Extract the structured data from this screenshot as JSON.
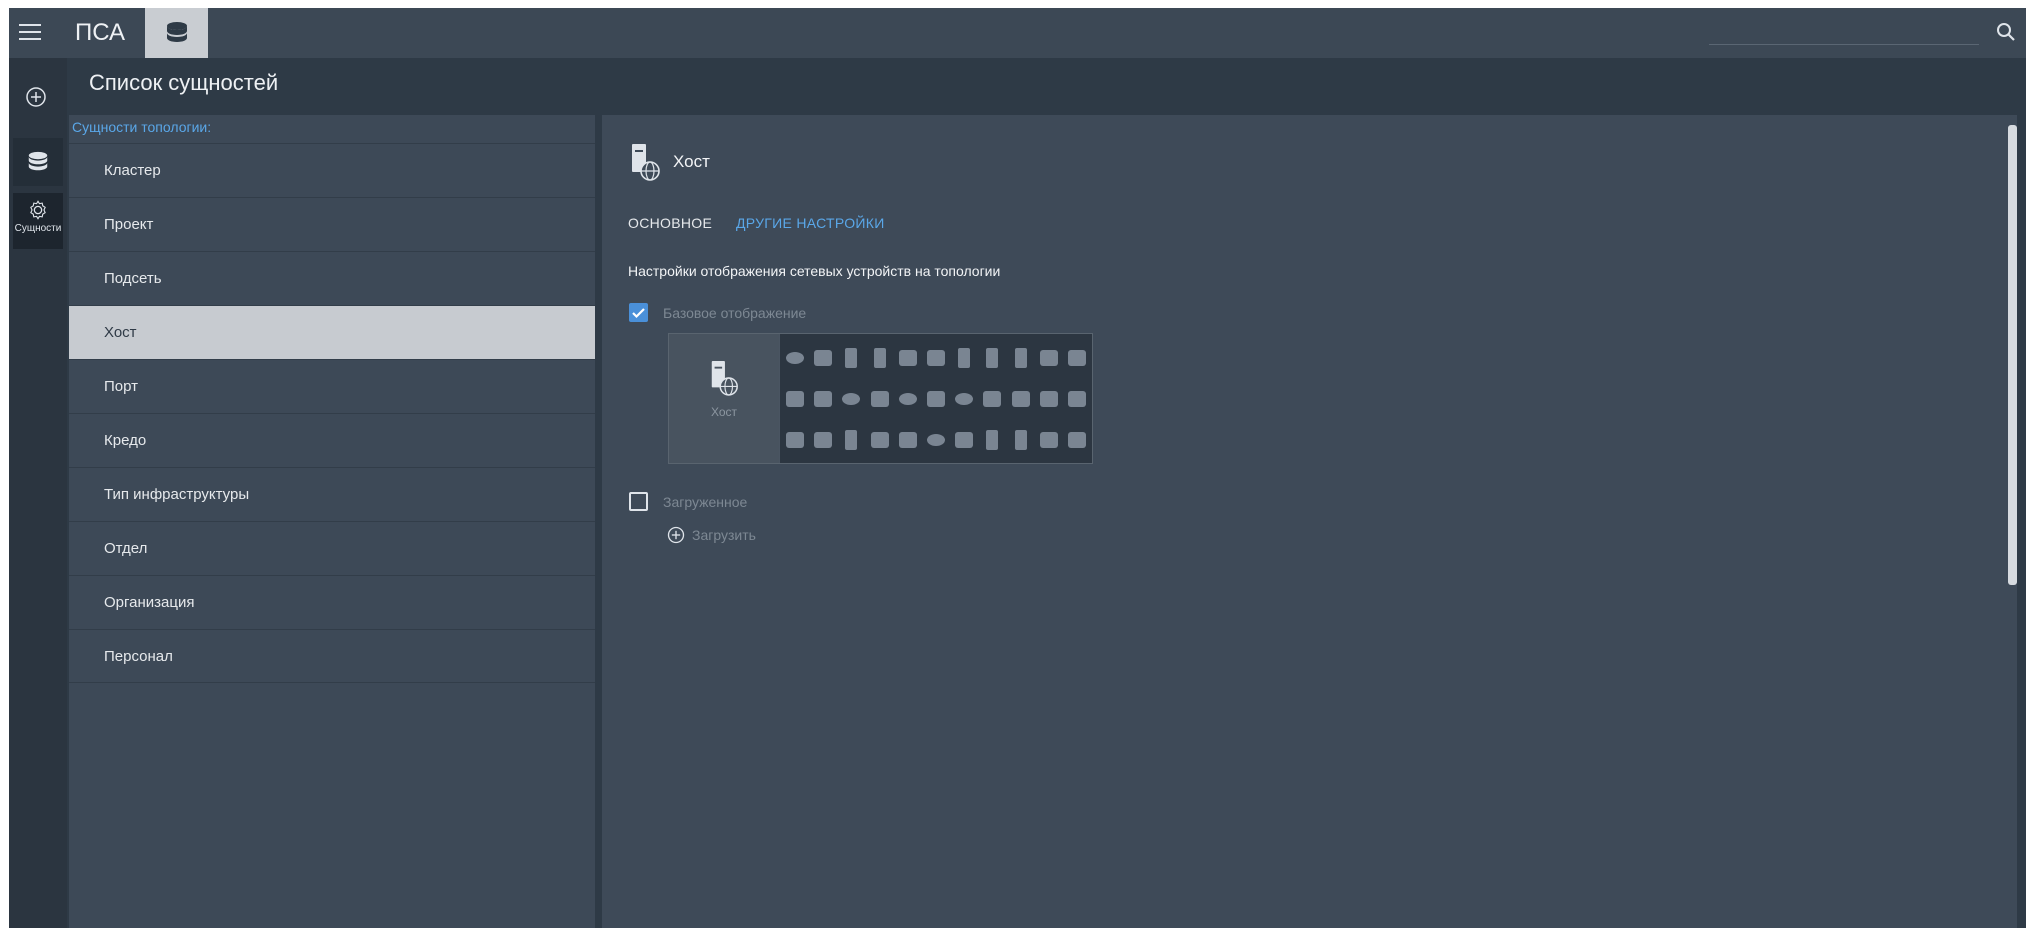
{
  "app": {
    "title": "ПСА"
  },
  "page": {
    "title": "Список сущностей"
  },
  "rail": {
    "entities_label": "Сущности"
  },
  "entities": {
    "header": "Сущности топологии:",
    "items": [
      {
        "label": "Кластер"
      },
      {
        "label": "Проект"
      },
      {
        "label": "Подсеть"
      },
      {
        "label": "Хост",
        "selected": true
      },
      {
        "label": "Порт"
      },
      {
        "label": "Кредо"
      },
      {
        "label": "Тип инфраструктуры"
      },
      {
        "label": "Отдел"
      },
      {
        "label": "Организация"
      },
      {
        "label": "Персонал"
      }
    ]
  },
  "detail": {
    "title": "Хост",
    "tabs": [
      {
        "label": "ОСНОВНОЕ",
        "active": true
      },
      {
        "label": "ДРУГИЕ НАСТРОЙКИ",
        "active": false
      }
    ],
    "section_label": "Настройки отображения сетевых устройств на топологии",
    "base_display": {
      "label": "Базовое отображение",
      "checked": true
    },
    "preview": {
      "label": "Хост"
    },
    "loaded": {
      "label": "Загруженное",
      "checked": false
    },
    "upload_label": "Загрузить"
  },
  "colors": {
    "accent": "#5aa7e8",
    "checkbox": "#4a90d9",
    "selected_row": "#c7cbd0"
  }
}
